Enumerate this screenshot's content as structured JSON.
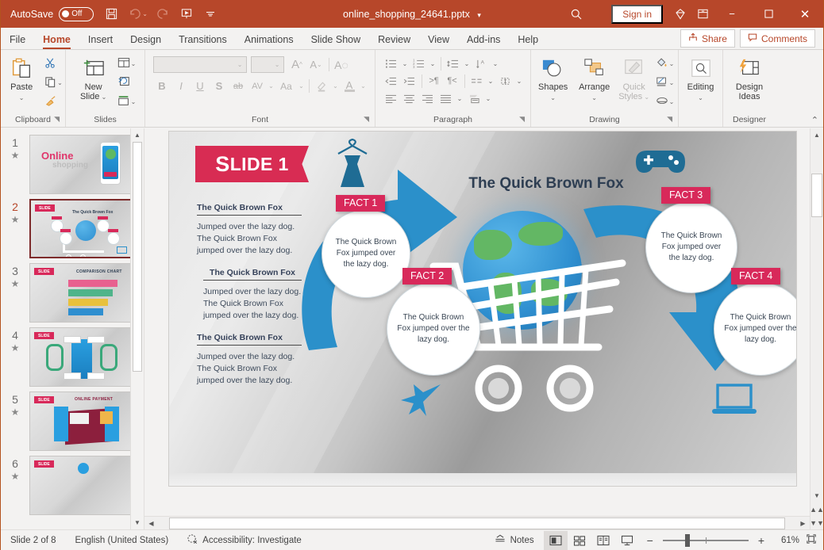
{
  "titlebar": {
    "autosave_label": "AutoSave",
    "autosave_state": "Off",
    "save_icon": "save-icon",
    "undo_icon": "undo-icon",
    "redo_icon": "redo-icon",
    "present_icon": "start-presentation-icon",
    "customize_icon": "customize-quick-access-icon",
    "document_title": "online_shopping_24641.pptx",
    "title_dropdown": "▾",
    "search_icon": "search-icon",
    "signin_label": "Sign in",
    "diamond_icon": "premium-diamond-icon",
    "ribbon_display_icon": "ribbon-display-options-icon",
    "minimize": "−",
    "maximize": "▢",
    "close": "✕",
    "bg_color": "#b7472a"
  },
  "tabs": {
    "items": [
      {
        "label": "File",
        "active": false
      },
      {
        "label": "Home",
        "active": true
      },
      {
        "label": "Insert",
        "active": false
      },
      {
        "label": "Design",
        "active": false
      },
      {
        "label": "Transitions",
        "active": false
      },
      {
        "label": "Animations",
        "active": false
      },
      {
        "label": "Slide Show",
        "active": false
      },
      {
        "label": "Review",
        "active": false
      },
      {
        "label": "View",
        "active": false
      },
      {
        "label": "Add-ins",
        "active": false
      },
      {
        "label": "Help",
        "active": false
      }
    ],
    "share_label": "Share",
    "comments_label": "Comments"
  },
  "ribbon": {
    "clipboard": {
      "label": "Clipboard",
      "paste_label": "Paste",
      "cut_label": "cut-scissors-icon",
      "copy_label": "copy-icon",
      "format_painter_label": "format-painter-icon"
    },
    "slides": {
      "label": "Slides",
      "new_slide_label": "New\nSlide",
      "new_slide_line1": "New",
      "new_slide_line2": "Slide",
      "layout_label": "layout-icon",
      "reset_label": "reset-icon",
      "section_label": "section-icon"
    },
    "font": {
      "label": "Font",
      "font_name_value": "",
      "font_size_value": "",
      "grow_label": "A",
      "shrink_label": "A",
      "clear_format_label": "A",
      "bold": "B",
      "italic": "I",
      "underline": "U",
      "shadow": "S",
      "strike": "ab",
      "spacing": "AV",
      "case": "Aa",
      "highlight": "highlight-icon",
      "fontcolor": "A"
    },
    "paragraph": {
      "label": "Paragraph",
      "bullets": "bullets-icon",
      "numbering": "numbering-icon",
      "line_spacing": "line-spacing-icon",
      "text_direction": "text-direction-icon",
      "decrease_indent": "decrease-indent-icon",
      "increase_indent": "increase-indent-icon",
      "rtl": "right-to-left-icon",
      "ltr": "left-to-right-icon",
      "columns": "columns-icon",
      "align_text": "align-text-icon",
      "align_left": "align-left-icon",
      "align_center": "align-center-icon",
      "align_right": "align-right-icon",
      "justify": "justify-icon",
      "smartart": "convert-to-smartart-icon"
    },
    "drawing": {
      "label": "Drawing",
      "shapes_label": "Shapes",
      "arrange_label": "Arrange",
      "quick_styles_line1": "Quick",
      "quick_styles_line2": "Styles",
      "shape_fill": "shape-fill-icon",
      "shape_outline": "shape-outline-icon",
      "shape_effects": "shape-effects-icon"
    },
    "editing": {
      "label": "",
      "editing_label": "Editing"
    },
    "designer": {
      "label": "Designer",
      "design_ideas_line1": "Design",
      "design_ideas_line2": "Ideas"
    },
    "collapse_icon": "collapse-ribbon-icon"
  },
  "thumbnails": [
    {
      "number": "1",
      "selected": false,
      "star": "★",
      "kind": "title"
    },
    {
      "number": "2",
      "selected": true,
      "star": "★",
      "kind": "infographic"
    },
    {
      "number": "3",
      "selected": false,
      "star": "★",
      "kind": "comparison"
    },
    {
      "number": "4",
      "selected": false,
      "star": "★",
      "kind": "mobile"
    },
    {
      "number": "5",
      "selected": false,
      "star": "★",
      "kind": "payment"
    },
    {
      "number": "6",
      "selected": false,
      "star": "★",
      "kind": "other"
    }
  ],
  "thumb_labels": {
    "slide1_title": "Online",
    "slide1_sub": "shopping",
    "slide3_title": "COMPARISON CHART",
    "slide5_title": "ONLINE PAYMENT",
    "badge": "SLIDE"
  },
  "slide": {
    "badge_cap": "S",
    "badge_rest": "LIDE 1",
    "title": "The Quick Brown Fox",
    "text_blocks": [
      {
        "heading": "The Quick Brown Fox",
        "body": "Jumped over the lazy dog. The Quick Brown Fox jumped over the lazy dog."
      },
      {
        "heading": "The Quick Brown Fox",
        "body": "Jumped over the lazy dog. The Quick Brown Fox jumped over the lazy dog."
      },
      {
        "heading": "The Quick Brown Fox",
        "body": "Jumped over the lazy dog. The Quick Brown Fox jumped over the lazy dog."
      }
    ],
    "facts": [
      {
        "tag": "FACT 1",
        "text": "The Quick Brown Fox jumped over the lazy dog."
      },
      {
        "tag": "FACT 2",
        "text": "The Quick Brown Fox jumped over the lazy dog."
      },
      {
        "tag": "FACT 3",
        "text": "The Quick Brown Fox jumped over the lazy dog."
      },
      {
        "tag": "FACT 4",
        "text": "The Quick Brown Fox jumped over the lazy dog."
      }
    ],
    "icons": [
      "dress-hanger-icon",
      "gamepad-icon",
      "airplane-icon",
      "laptop-icon",
      "shopping-cart-icon",
      "globe-icon"
    ],
    "accent_pink": "#d8295a",
    "accent_blue": "#2b90ca"
  },
  "status": {
    "slide_counter": "Slide 2 of 8",
    "language": "English (United States)",
    "accessibility": "Accessibility: Investigate",
    "accessibility_icon": "accessibility-icon",
    "notes_label": "Notes",
    "views": [
      {
        "name": "normal-view",
        "active": true
      },
      {
        "name": "slide-sorter-view",
        "active": false
      },
      {
        "name": "reading-view",
        "active": false
      },
      {
        "name": "slide-show-view",
        "active": false
      }
    ],
    "zoom_out": "−",
    "zoom_in": "+",
    "zoom_level": "61%",
    "fit_icon": "fit-slide-to-window-icon"
  }
}
